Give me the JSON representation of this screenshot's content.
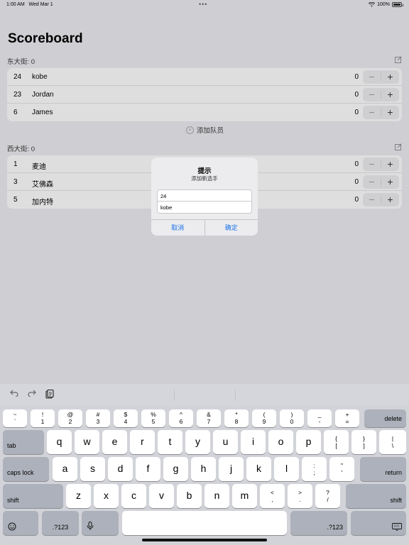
{
  "status_bar": {
    "time": "1:00 AM",
    "date": "Wed Mar 1",
    "battery": "100%"
  },
  "title": "Scoreboard",
  "teams": [
    {
      "label": "东大街: 0",
      "players": [
        {
          "number": "24",
          "name": "kobe",
          "score": "0"
        },
        {
          "number": "23",
          "name": "Jordan",
          "score": "0"
        },
        {
          "number": "6",
          "name": "James",
          "score": "0"
        }
      ],
      "add_label": "添加队员"
    },
    {
      "label": "西大街: 0",
      "players": [
        {
          "number": "1",
          "name": "麦迪",
          "score": "0"
        },
        {
          "number": "3",
          "name": "艾佛森",
          "score": "0"
        },
        {
          "number": "5",
          "name": "加内特",
          "score": "0"
        }
      ]
    }
  ],
  "stepper": {
    "minus": "−",
    "plus": "+"
  },
  "alert": {
    "title": "提示",
    "message": "添加新选手",
    "field1_value": "24",
    "field2_value": "kobe",
    "cancel": "取消",
    "confirm": "确定"
  },
  "keyboard": {
    "toolbar_icons": [
      "undo-icon",
      "redo-icon",
      "paste-icon"
    ],
    "row1": [
      {
        "top": "~",
        "bot": "`"
      },
      {
        "top": "!",
        "bot": "1"
      },
      {
        "top": "@",
        "bot": "2"
      },
      {
        "top": "#",
        "bot": "3"
      },
      {
        "top": "$",
        "bot": "4"
      },
      {
        "top": "%",
        "bot": "5"
      },
      {
        "top": "^",
        "bot": "6"
      },
      {
        "top": "&",
        "bot": "7"
      },
      {
        "top": "*",
        "bot": "8"
      },
      {
        "top": "(",
        "bot": "9"
      },
      {
        "top": ")",
        "bot": "0"
      },
      {
        "top": "_",
        "bot": "-"
      },
      {
        "top": "+",
        "bot": "="
      }
    ],
    "row2": [
      "q",
      "w",
      "e",
      "r",
      "t",
      "y",
      "u",
      "i",
      "o",
      "p"
    ],
    "row2_extra": [
      {
        "top": "{",
        "bot": "["
      },
      {
        "top": "}",
        "bot": "]"
      },
      {
        "top": "|",
        "bot": "\\"
      }
    ],
    "row3": [
      "a",
      "s",
      "d",
      "f",
      "g",
      "h",
      "j",
      "k",
      "l"
    ],
    "row3_extra": [
      {
        "top": ":",
        "bot": ";"
      },
      {
        "top": "\"",
        "bot": "'"
      }
    ],
    "row4": [
      "z",
      "x",
      "c",
      "v",
      "b",
      "n",
      "m"
    ],
    "row4_extra": [
      {
        "top": "<",
        "bot": ","
      },
      {
        "top": ">",
        "bot": "."
      },
      {
        "top": "?",
        "bot": "/"
      }
    ],
    "delete": "delete",
    "tab": "tab",
    "caps_lock": "caps lock",
    "return": "return",
    "shift": "shift",
    "numbers": ".?123"
  }
}
